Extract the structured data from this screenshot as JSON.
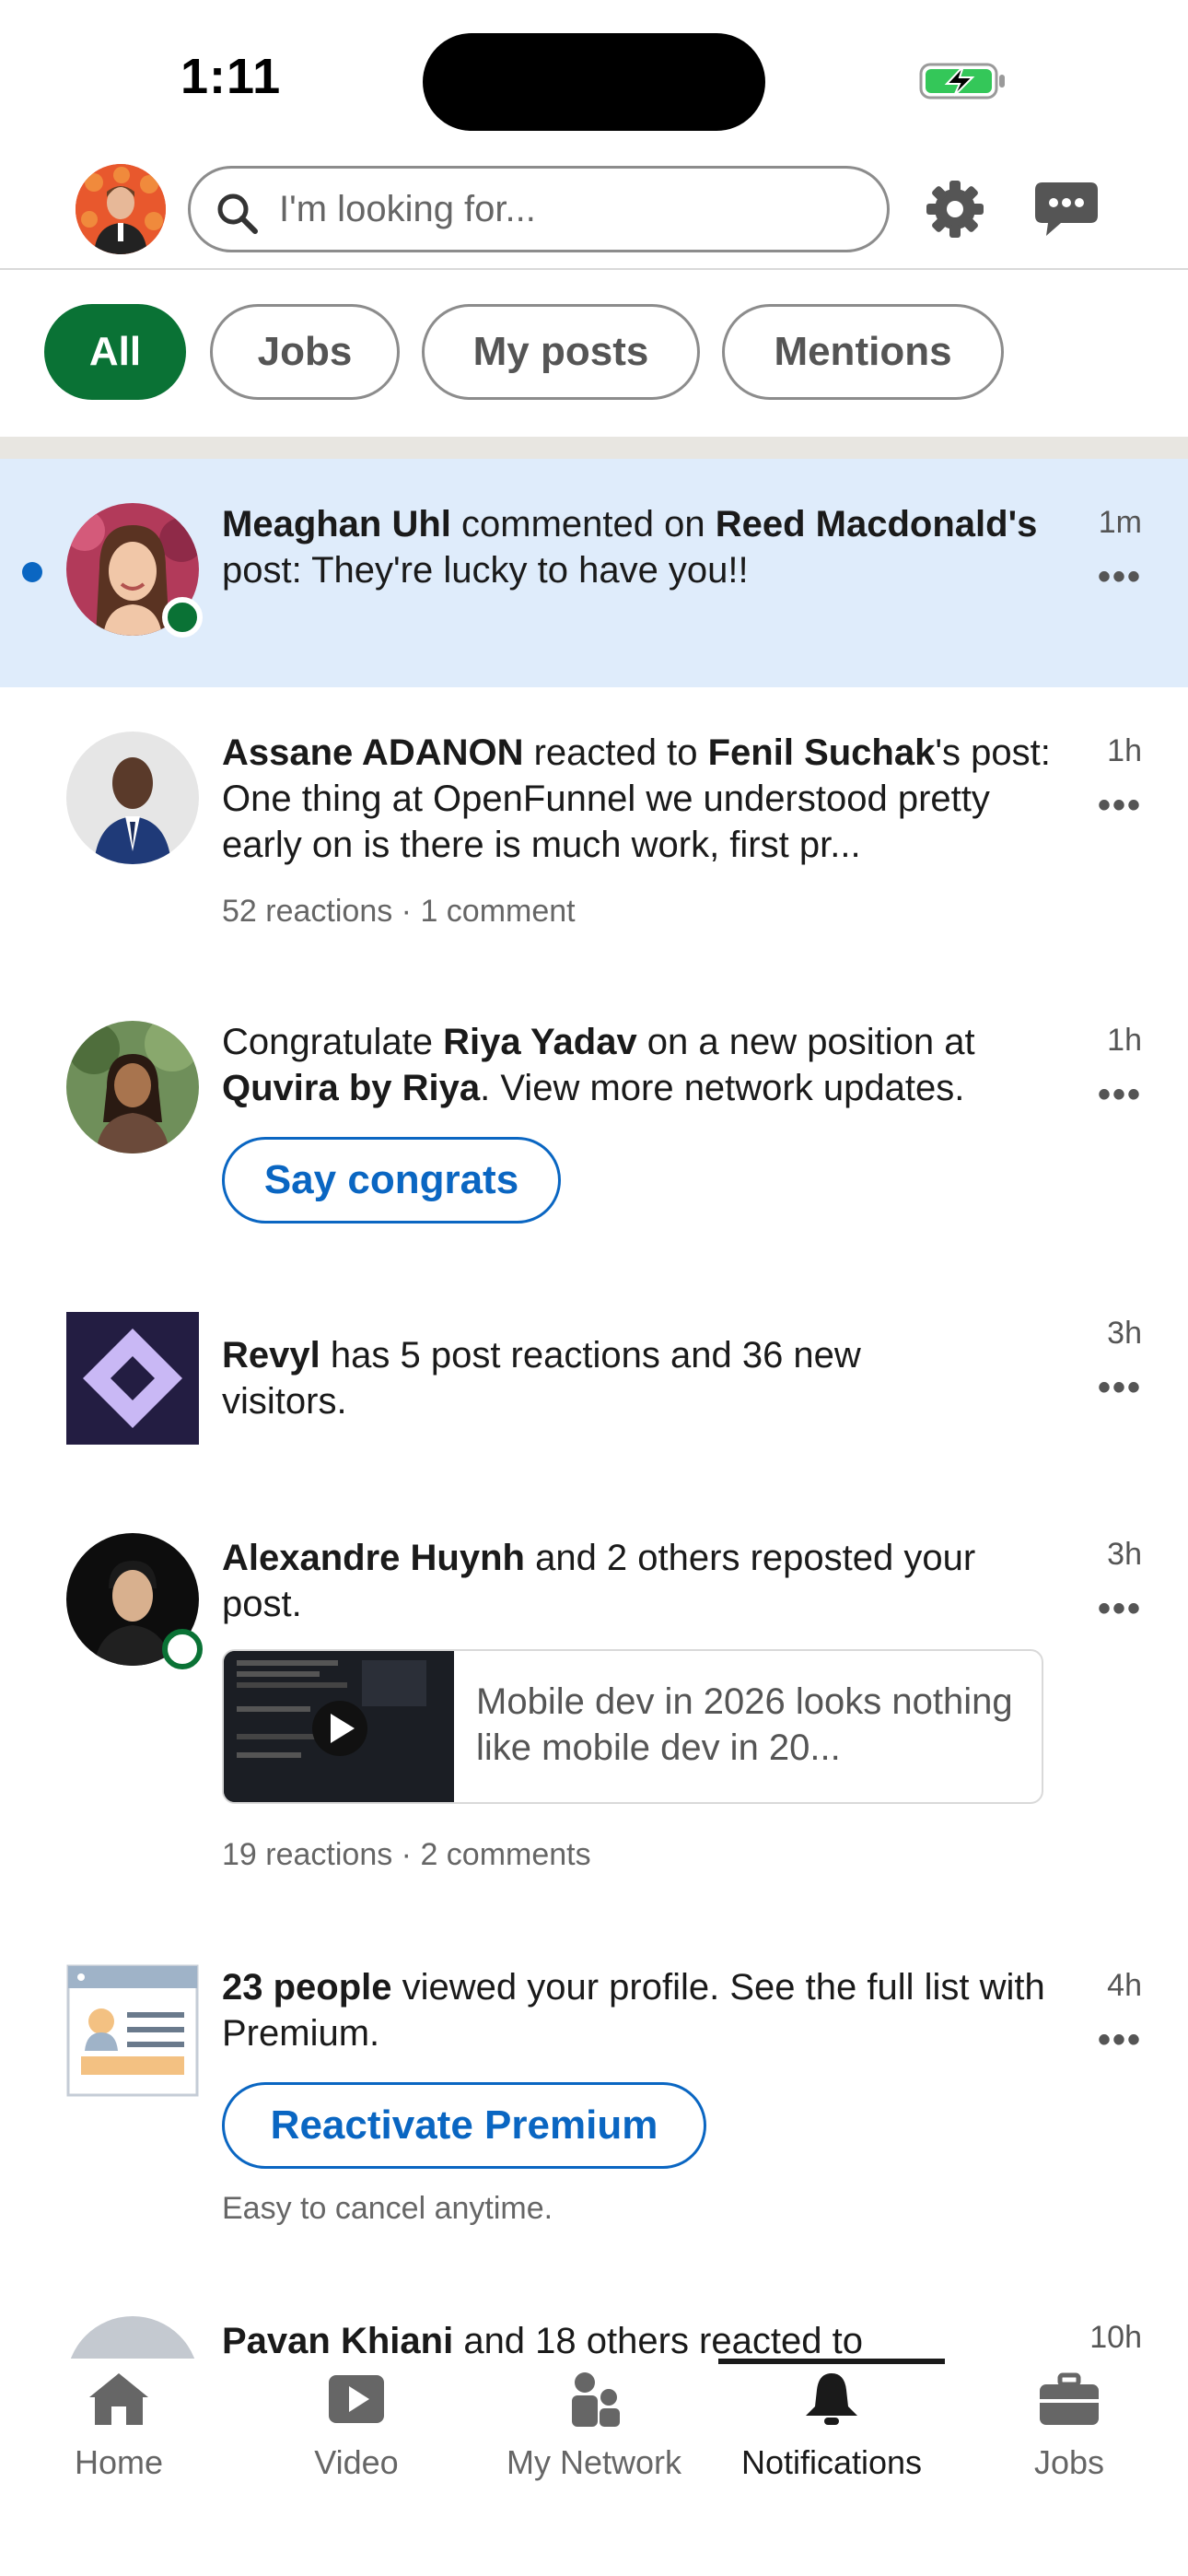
{
  "status_bar": {
    "time": "1:11"
  },
  "header": {
    "search_placeholder": "I'm looking for..."
  },
  "filters": [
    "All",
    "Jobs",
    "My posts",
    "Mentions"
  ],
  "notifications": [
    {
      "name": "Meaghan Uhl",
      "text_1": " commented on ",
      "target": "Reed Macdonald's",
      "text_2": " post: They're lucky to have you!!",
      "time": "1m",
      "unread": true
    },
    {
      "name": "Assane ADANON",
      "text_1": " reacted to ",
      "target": "Fenil Suchak",
      "text_2": "'s post: One thing at OpenFunnel we understood pretty early on is there is much work, first pr...",
      "meta": "52 reactions · 1 comment",
      "time": "1h"
    },
    {
      "text_0": "Congratulate ",
      "name": "Riya Yadav",
      "text_1": " on a new position at ",
      "target": "Quvira by Riya",
      "text_2": ". View more network updates.",
      "cta": "Say congrats",
      "time": "1h"
    },
    {
      "name": "Revyl",
      "text_1": " has 5 post reactions and 36 new visitors.",
      "time": "3h"
    },
    {
      "name": "Alexandre Huynh",
      "text_1": " and 2 others reposted your post.",
      "preview": "Mobile dev in 2026 looks nothing like mobile dev in 20...",
      "meta": "19 reactions · 2 comments",
      "time": "3h"
    },
    {
      "name": "23 people",
      "text_1": " viewed your profile. See the full list with Premium.",
      "cta": "Reactivate Premium",
      "meta": "Easy to cancel anytime.",
      "time": "4h"
    },
    {
      "name": "Pavan Khiani",
      "text_1": " and 18 others reacted to",
      "time": "10h"
    }
  ],
  "bottom_nav": [
    {
      "label": "Home",
      "icon": "home-icon"
    },
    {
      "label": "Video",
      "icon": "video-icon"
    },
    {
      "label": "My Network",
      "icon": "network-icon"
    },
    {
      "label": "Notifications",
      "icon": "bell-icon",
      "active": true
    },
    {
      "label": "Jobs",
      "icon": "briefcase-icon"
    }
  ],
  "colors": {
    "accent_green": "#0a7235",
    "link_blue": "#0a66c2",
    "unread_bg": "#dfecfb"
  }
}
